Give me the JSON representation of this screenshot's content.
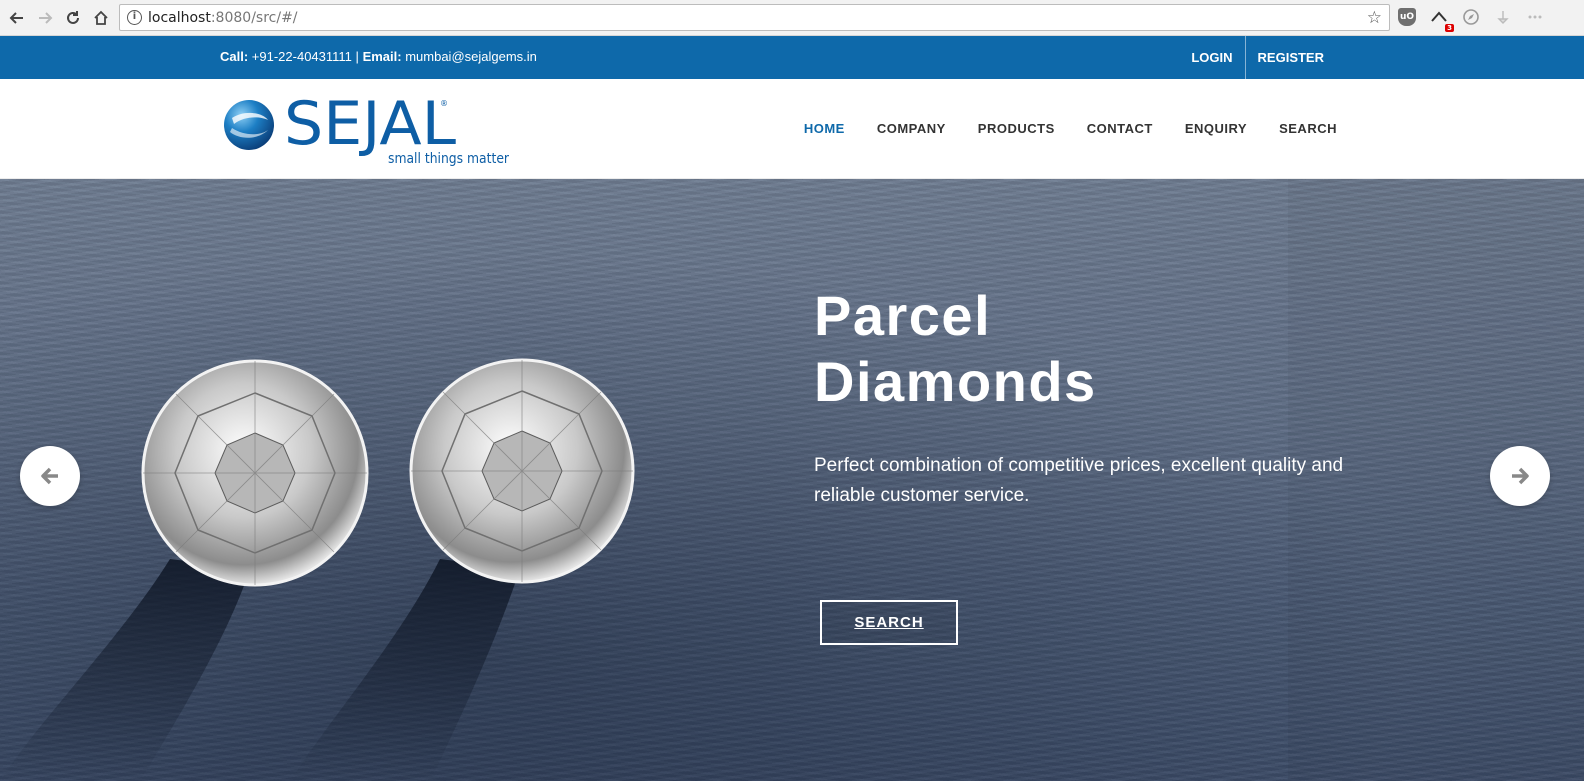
{
  "browser": {
    "url_host": "localhost",
    "url_rest": ":8080/src/#/",
    "extension_badge": "3",
    "extension_shield_label": "uO"
  },
  "topbar": {
    "call_label": "Call:",
    "call_value": "+91-22-40431111",
    "divider": "|",
    "email_label": "Email:",
    "email_value": "mumbai@sejalgems.in",
    "login": "LOGIN",
    "register": "REGISTER"
  },
  "logo": {
    "name": "SEJAL",
    "tagline": "small things matter",
    "registered": "®"
  },
  "nav": {
    "items": [
      {
        "label": "HOME",
        "active": true
      },
      {
        "label": "COMPANY",
        "active": false
      },
      {
        "label": "PRODUCTS",
        "active": false
      },
      {
        "label": "CONTACT",
        "active": false
      },
      {
        "label": "ENQUIRY",
        "active": false
      },
      {
        "label": "SEARCH",
        "active": false
      }
    ]
  },
  "hero": {
    "title_line1": "Parcel",
    "title_line2": "Diamonds",
    "subtitle": "Perfect combination of competitive prices, excellent quality and reliable customer service.",
    "button": "SEARCH"
  },
  "colors": {
    "brand_blue": "#0e69aa",
    "nav_text": "#333333"
  }
}
